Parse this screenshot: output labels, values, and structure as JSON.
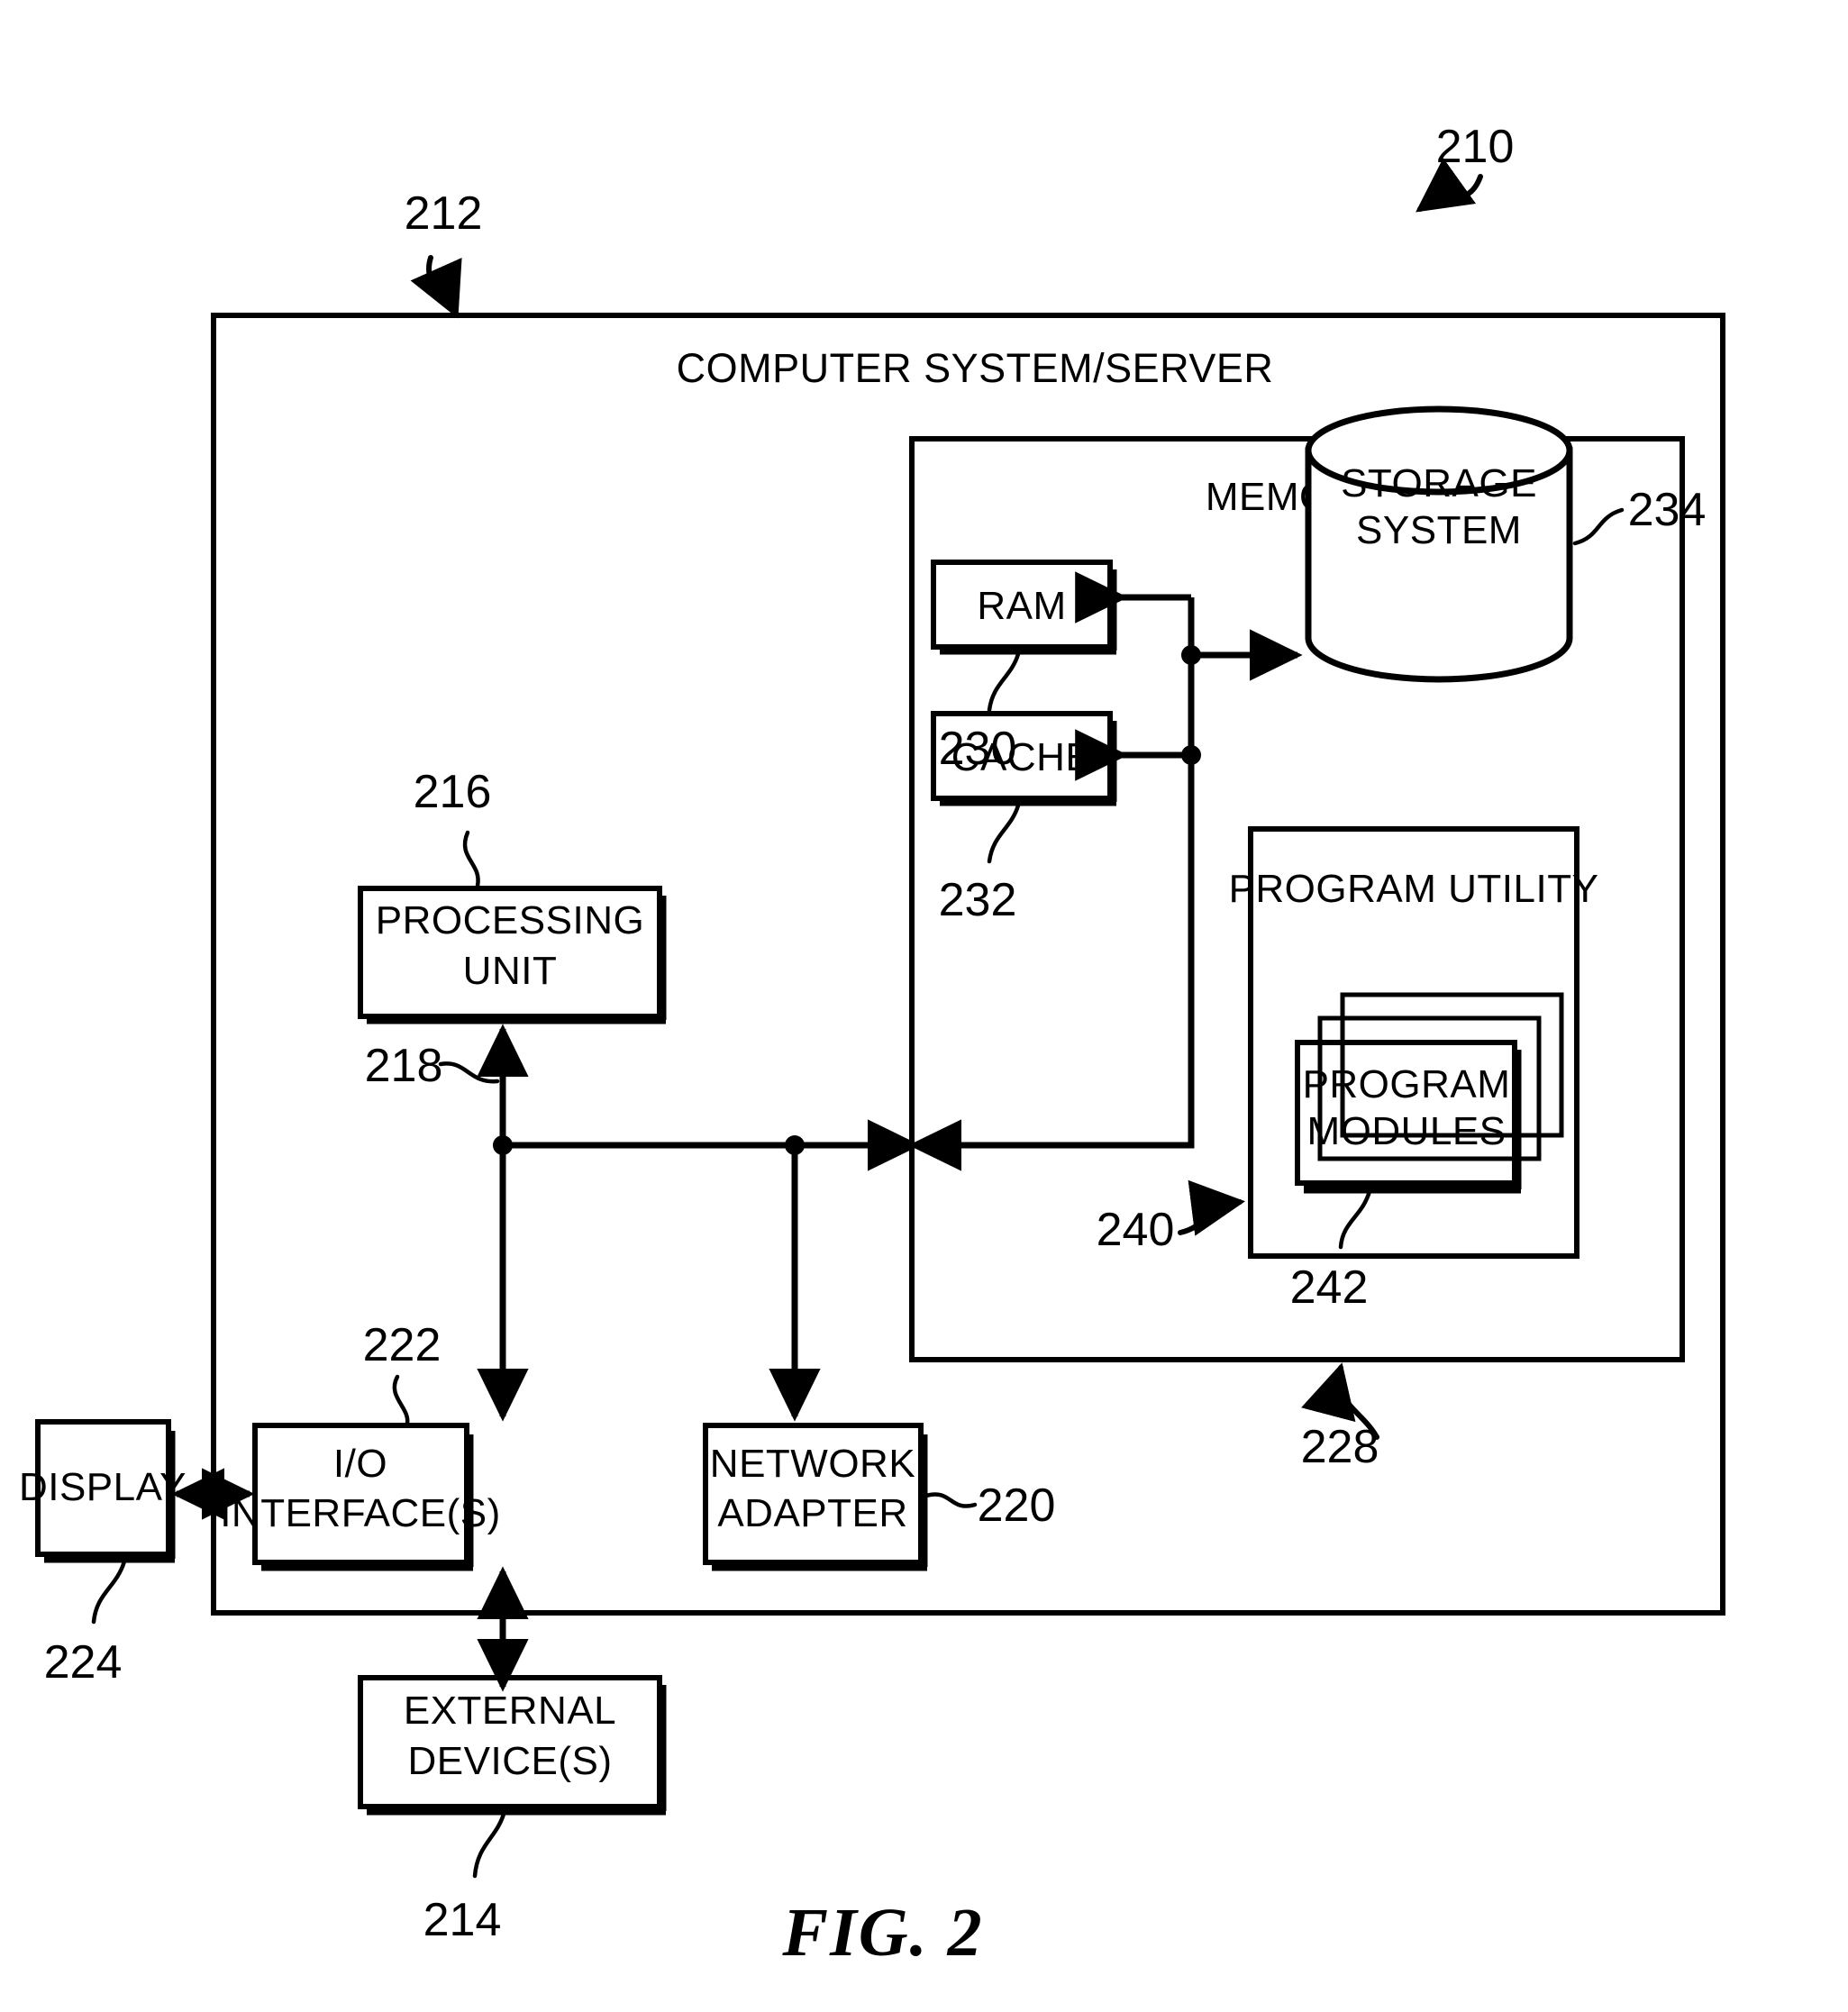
{
  "figure": {
    "caption": "FIG. 2",
    "domain_note": "patent block diagram"
  },
  "title": "COMPUTER SYSTEM/SERVER",
  "blocks": {
    "memory": "MEMORY",
    "ram": "RAM",
    "cache": "CACHE",
    "storage_system_line1": "STORAGE",
    "storage_system_line2": "SYSTEM",
    "program_utility": "PROGRAM UTILITY",
    "program_modules_line1": "PROGRAM",
    "program_modules_line2": "MODULES",
    "processing_unit_line1": "PROCESSING",
    "processing_unit_line2": "UNIT",
    "io_interface_line1": "I/O",
    "io_interface_line2": "INTERFACE(S)",
    "network_adapter_line1": "NETWORK",
    "network_adapter_line2": "ADAPTER",
    "display": "DISPLAY",
    "external_devices_line1": "EXTERNAL",
    "external_devices_line2": "DEVICE(S)"
  },
  "reference_numerals": {
    "system": "210",
    "computer_system_server": "212",
    "external_devices": "214",
    "processing_unit": "216",
    "bus": "218",
    "network_adapter": "220",
    "io_interfaces": "222",
    "display": "224",
    "memory": "228",
    "ram": "230",
    "cache": "232",
    "storage_system": "234",
    "program_utility": "240",
    "program_modules": "242"
  },
  "colors": {
    "ink": "#000000",
    "paper": "#ffffff"
  }
}
